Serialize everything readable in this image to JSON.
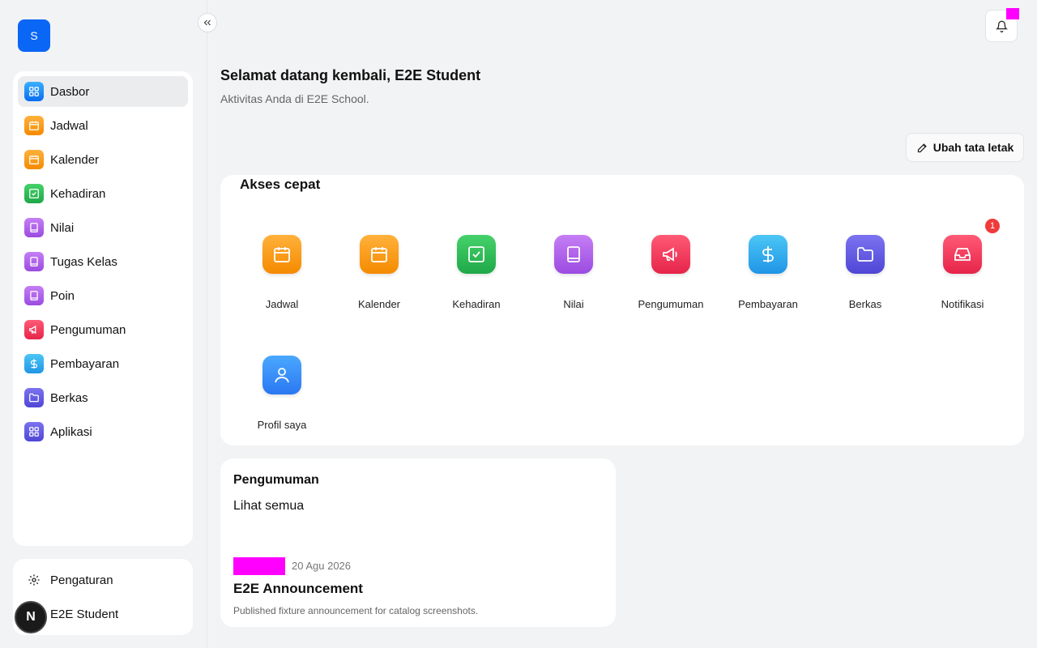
{
  "app": {
    "logo_letter": "S"
  },
  "sidebar": {
    "items": [
      {
        "label": "Dasbor",
        "icon": "grid-icon",
        "active": true
      },
      {
        "label": "Jadwal",
        "icon": "calendar-icon"
      },
      {
        "label": "Kalender",
        "icon": "calendar-icon"
      },
      {
        "label": "Kehadiran",
        "icon": "check-square-icon"
      },
      {
        "label": "Nilai",
        "icon": "book-icon"
      },
      {
        "label": "Tugas Kelas",
        "icon": "book-icon"
      },
      {
        "label": "Poin",
        "icon": "book-icon"
      },
      {
        "label": "Pengumuman",
        "icon": "megaphone-icon"
      },
      {
        "label": "Pembayaran",
        "icon": "dollar-icon"
      },
      {
        "label": "Berkas",
        "icon": "folder-icon"
      },
      {
        "label": "Aplikasi",
        "icon": "apps-icon"
      }
    ],
    "settings_label": "Pengaturan",
    "user_name": "E2E Student",
    "avatar_letter": "N"
  },
  "header": {
    "greeting": "Selamat datang kembali, E2E Student",
    "subtitle": "Aktivitas Anda di E2E School.",
    "edit_layout_label": "Ubah tata letak"
  },
  "quick_access": {
    "title": "Akses cepat",
    "tiles": [
      {
        "label": "Jadwal",
        "icon": "calendar-icon"
      },
      {
        "label": "Kalender",
        "icon": "calendar-icon"
      },
      {
        "label": "Kehadiran",
        "icon": "check-square-icon"
      },
      {
        "label": "Nilai",
        "icon": "book-icon"
      },
      {
        "label": "Pengumuman",
        "icon": "megaphone-icon"
      },
      {
        "label": "Pembayaran",
        "icon": "dollar-icon"
      },
      {
        "label": "Berkas",
        "icon": "folder-icon"
      },
      {
        "label": "Notifikasi",
        "icon": "inbox-icon",
        "badge": "1"
      },
      {
        "label": "Profil saya",
        "icon": "user-icon"
      }
    ]
  },
  "announcements": {
    "title": "Pengumuman",
    "view_all": "Lihat semua",
    "item": {
      "date": "20 Agu 2026",
      "title": "E2E Announcement",
      "description": "Published fixture announcement for catalog screenshots."
    }
  },
  "colors": {
    "primary": "#0a66f5",
    "badge_red": "#ef3b3b",
    "placeholder_magenta": "#ff00ff"
  }
}
